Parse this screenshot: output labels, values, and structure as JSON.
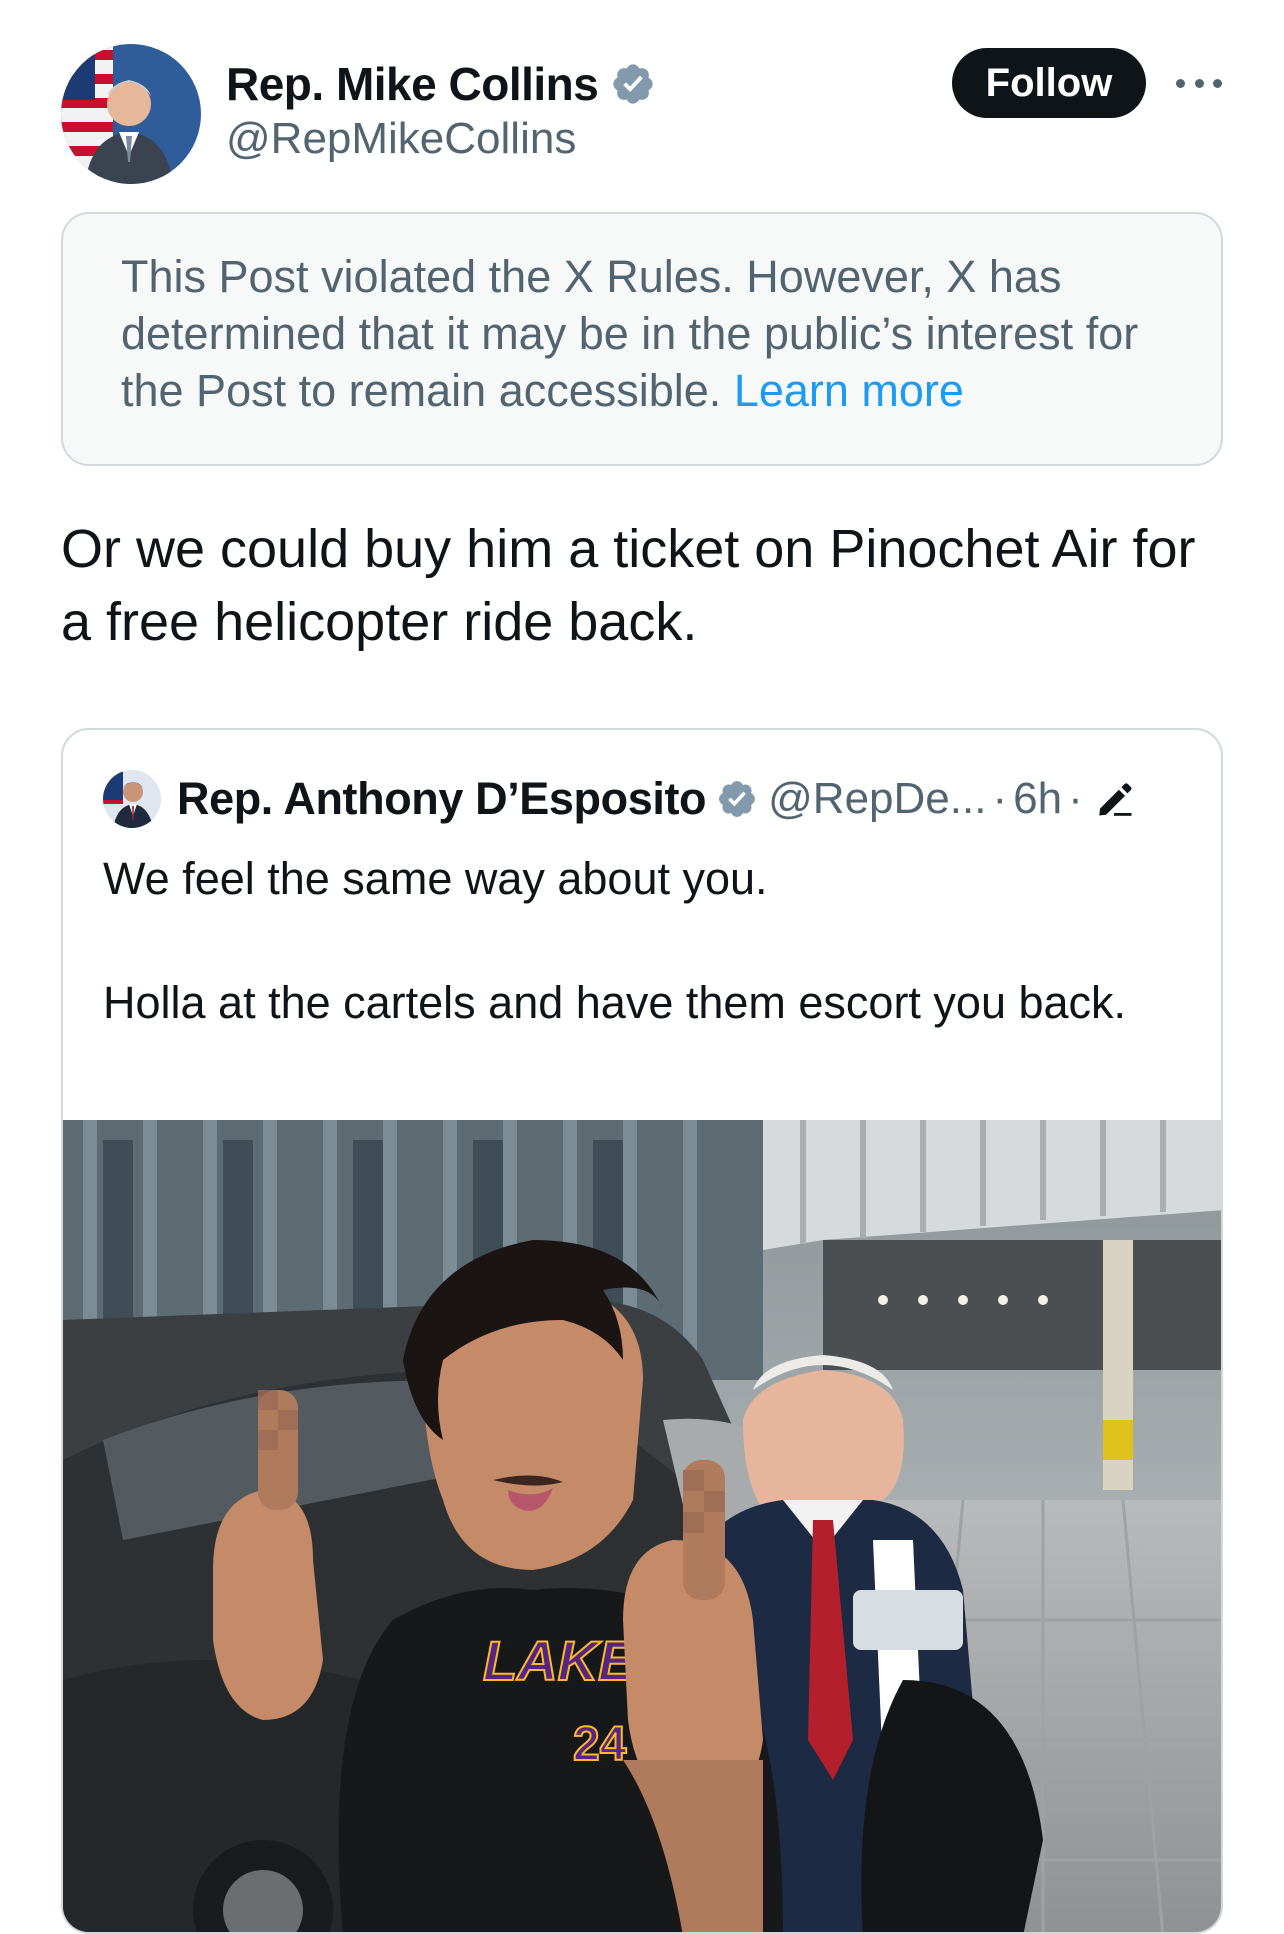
{
  "author": {
    "name": "Rep. Mike Collins",
    "handle": "@RepMikeCollins",
    "verified_icon": "verified-badge-icon"
  },
  "actions": {
    "follow_label": "Follow",
    "more_icon": "more-options-icon"
  },
  "notice": {
    "text": "This Post violated the X Rules. However, X has determined that it may be in the public’s interest for the Post to remain accessible.",
    "link_label": "Learn more"
  },
  "post": {
    "text": "Or we could buy him a ticket on Pinochet Air for a free helicopter ride back."
  },
  "quoted_post": {
    "author_name": "Rep. Anthony D’Esposito",
    "handle": "@RepDe...",
    "separator": "·",
    "time": "6h",
    "edited_icon": "edit-pencil-icon",
    "paragraphs": [
      "We feel the same way about you.",
      "Holla at the cartels and have them escort you back."
    ],
    "media": {
      "shirt_text": "LAKERS",
      "shirt_number": "24"
    }
  },
  "colors": {
    "text_primary": "#0f1419",
    "text_secondary": "#536471",
    "link": "#1d9bf0",
    "verified": "#829aab",
    "notice_bg": "#f7f9f9",
    "border": "#cfd9de",
    "lakers_purple": "#552583",
    "lakers_gold": "#fdb927"
  }
}
